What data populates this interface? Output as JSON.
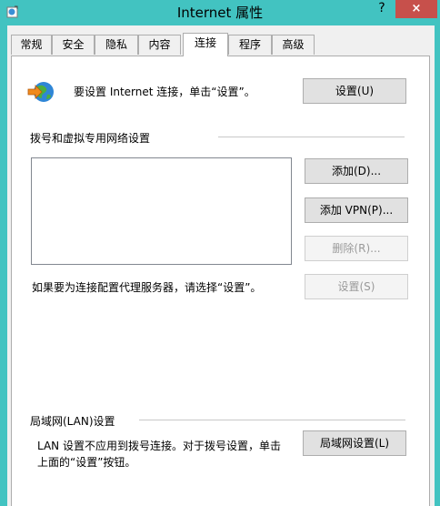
{
  "window": {
    "title": "Internet 属性",
    "help_label": "?",
    "close_label": "×"
  },
  "tabs": [
    {
      "label": "常规"
    },
    {
      "label": "安全"
    },
    {
      "label": "隐私"
    },
    {
      "label": "内容"
    },
    {
      "label": "连接",
      "active": true
    },
    {
      "label": "程序"
    },
    {
      "label": "高级"
    }
  ],
  "setup": {
    "text": "要设置 Internet 连接，单击“设置”。",
    "button": "设置(U)"
  },
  "dialup": {
    "heading": "拨号和虚拟专用网络设置",
    "add_button": "添加(D)...",
    "add_vpn_button": "添加 VPN(P)...",
    "remove_button": "删除(R)...",
    "proxy_text": "如果要为连接配置代理服务器，请选择“设置”。",
    "settings_button": "设置(S)"
  },
  "lan": {
    "heading": "局域网(LAN)设置",
    "text_line1": "LAN 设置不应用到拨号连接。对于拨号设置，单击",
    "text_line2": "上面的“设置”按钮。",
    "button": "局域网设置(L)"
  },
  "icons": {
    "app": "internet-options-icon",
    "setup": "globe-connect-icon"
  },
  "colors": {
    "desktop": "#42c3c1",
    "close": "#c7504b",
    "panel": "#ffffff",
    "dialog": "#f0f0f0"
  }
}
